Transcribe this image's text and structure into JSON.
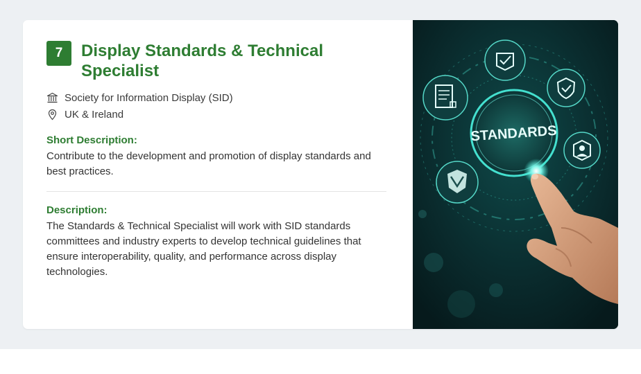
{
  "job": {
    "number": "7",
    "title": "Display Standards & Technical Specialist",
    "organization": "Society for Information Display (SID)",
    "location": "UK & Ireland",
    "short_description_label": "Short Description:",
    "short_description": "Contribute to the development and promotion of display standards and best practices.",
    "description_label": "Description:",
    "description": "The Standards & Technical Specialist will work with SID standards committees and industry experts to develop technical guidelines that ensure interoperability, quality, and performance across display technologies."
  },
  "image": {
    "ring_label": "STANDARDS"
  },
  "colors": {
    "accent": "#2e7d32",
    "page_background": "#edf0f3",
    "card_background": "#ffffff",
    "text": "#333333"
  },
  "icons": {
    "organization": "institution-icon",
    "location": "map-pin-icon"
  }
}
